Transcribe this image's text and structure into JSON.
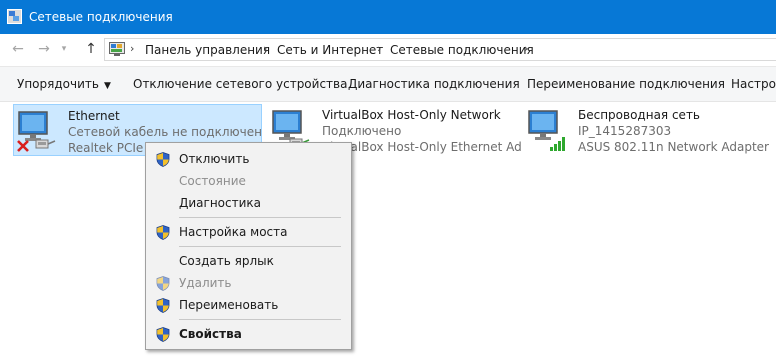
{
  "window": {
    "title": "Сетевые подключения"
  },
  "address": {
    "breadcrumbs": [
      "Панель управления",
      "Сеть и Интернет",
      "Сетевые подключения"
    ]
  },
  "toolbar": {
    "organize": "Упорядочить",
    "disable": "Отключение сетевого устройства",
    "diagnose": "Диагностика подключения",
    "rename": "Переименование подключения",
    "settings": "Настрой"
  },
  "connections": [
    {
      "name": "Ethernet",
      "status": "Сетевой кабель не подключен",
      "adapter": "Realtek PCIe G"
    },
    {
      "name": "VirtualBox Host-Only Network",
      "status": "Подключено",
      "adapter": "VirtualBox Host-Only Ethernet Ad"
    },
    {
      "name": "Беспроводная сеть",
      "status": "IP_1415287303",
      "adapter": "ASUS 802.11n Network Adapter"
    }
  ],
  "context_menu": {
    "disable": "Отключить",
    "status": "Состояние",
    "diagnostics": "Диагностика",
    "bridge": "Настройка моста",
    "shortcut": "Создать ярлык",
    "delete": "Удалить",
    "rename": "Переименовать",
    "properties": "Свойства"
  },
  "colors": {
    "titlebar": "#0778d6",
    "selection": "#cce8ff",
    "selection_border": "#99d1ff",
    "disabled_text": "#8d8d8d",
    "status_text": "#6d6d6d"
  },
  "icons": [
    "network-connections-icon",
    "back-arrow-icon",
    "forward-arrow-icon",
    "up-arrow-icon",
    "control-panel-icon",
    "dropdown-icon",
    "monitor-icon",
    "red-x-icon",
    "ethernet-cable-icon",
    "wifi-signal-icon",
    "uac-shield-icon"
  ]
}
